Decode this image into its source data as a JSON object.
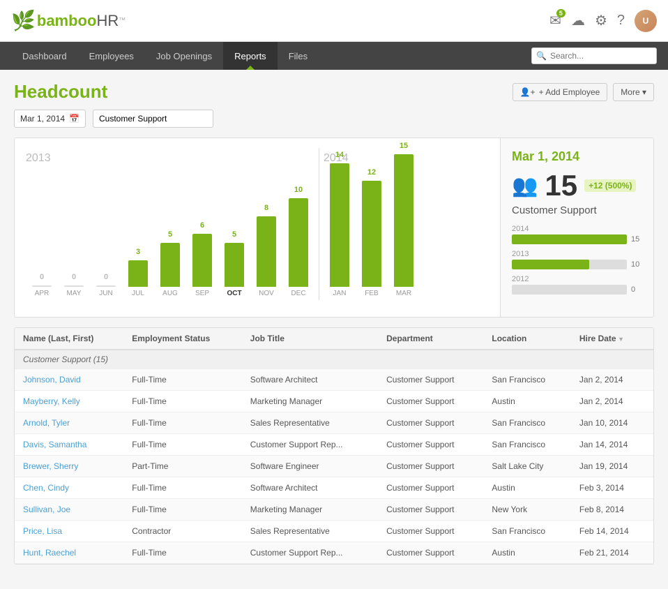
{
  "app": {
    "logo_bamboo": "bamboo",
    "logo_hr": "HR",
    "logo_tm": "™"
  },
  "top_icons": {
    "notifications_count": "5",
    "notifications_label": "Notifications",
    "cloud_label": "Cloud",
    "settings_label": "Settings",
    "help_label": "Help",
    "avatar_label": "User Avatar"
  },
  "nav": {
    "items": [
      {
        "label": "Dashboard",
        "active": false
      },
      {
        "label": "Employees",
        "active": false
      },
      {
        "label": "Job Openings",
        "active": false
      },
      {
        "label": "Reports",
        "active": true
      },
      {
        "label": "Files",
        "active": false
      }
    ],
    "search_placeholder": "Search..."
  },
  "page": {
    "title": "Headcount",
    "add_employee_label": "+ Add Employee",
    "more_label": "More ▾"
  },
  "filters": {
    "date_value": "Mar 1, 2014",
    "calendar_icon": "📅",
    "department_value": "Customer Support"
  },
  "chart": {
    "year_2013_label": "2013",
    "year_2014_label": "2014",
    "bars_2013": [
      {
        "month": "APR",
        "value": 0
      },
      {
        "month": "MAY",
        "value": 0
      },
      {
        "month": "JUN",
        "value": 0
      },
      {
        "month": "JUL",
        "value": 3
      },
      {
        "month": "AUG",
        "value": 5
      },
      {
        "month": "SEP",
        "value": 6
      },
      {
        "month": "OCT",
        "value": 5,
        "bold": true
      },
      {
        "month": "NOV",
        "value": 8
      },
      {
        "month": "DEC",
        "value": 10
      }
    ],
    "bars_2014": [
      {
        "month": "JAN",
        "value": 14
      },
      {
        "month": "FEB",
        "value": 12
      },
      {
        "month": "MAR",
        "value": 15
      }
    ],
    "max_value": 15
  },
  "summary": {
    "date_label": "Mar 1, 2014",
    "count": "15",
    "change_label": "+12 (500%)",
    "department": "Customer Support",
    "years": [
      {
        "year": "2014",
        "value": 15,
        "max": 15
      },
      {
        "year": "2013",
        "value": 10,
        "max": 15
      },
      {
        "year": "2012",
        "value": 0,
        "max": 15
      }
    ]
  },
  "table": {
    "columns": [
      {
        "label": "Name (Last, First)",
        "key": "name"
      },
      {
        "label": "Employment Status",
        "key": "status"
      },
      {
        "label": "Job Title",
        "key": "job_title"
      },
      {
        "label": "Department",
        "key": "department"
      },
      {
        "label": "Location",
        "key": "location"
      },
      {
        "label": "Hire Date",
        "key": "hire_date",
        "sortable": true
      }
    ],
    "group_label": "Customer Support (15)",
    "rows": [
      {
        "name": "Johnson, David",
        "status": "Full-Time",
        "job_title": "Software Architect",
        "department": "Customer Support",
        "location": "San Francisco",
        "hire_date": "Jan 2, 2014"
      },
      {
        "name": "Mayberry, Kelly",
        "status": "Full-Time",
        "job_title": "Marketing Manager",
        "department": "Customer Support",
        "location": "Austin",
        "hire_date": "Jan 2, 2014"
      },
      {
        "name": "Arnold, Tyler",
        "status": "Full-Time",
        "job_title": "Sales Representative",
        "department": "Customer Support",
        "location": "San Francisco",
        "hire_date": "Jan 10, 2014"
      },
      {
        "name": "Davis, Samantha",
        "status": "Full-Time",
        "job_title": "Customer Support Rep...",
        "department": "Customer Support",
        "location": "San Francisco",
        "hire_date": "Jan 14, 2014"
      },
      {
        "name": "Brewer, Sherry",
        "status": "Part-Time",
        "job_title": "Software Engineer",
        "department": "Customer Support",
        "location": "Salt Lake City",
        "hire_date": "Jan 19, 2014"
      },
      {
        "name": "Chen, Cindy",
        "status": "Full-Time",
        "job_title": "Software Architect",
        "department": "Customer Support",
        "location": "Austin",
        "hire_date": "Feb 3, 2014"
      },
      {
        "name": "Sullivan, Joe",
        "status": "Full-Time",
        "job_title": "Marketing Manager",
        "department": "Customer Support",
        "location": "New York",
        "hire_date": "Feb 8, 2014"
      },
      {
        "name": "Price, Lisa",
        "status": "Contractor",
        "job_title": "Sales Representative",
        "department": "Customer Support",
        "location": "San Francisco",
        "hire_date": "Feb 14, 2014"
      },
      {
        "name": "Hunt, Raechel",
        "status": "Full-Time",
        "job_title": "Customer Support Rep...",
        "department": "Customer Support",
        "location": "Austin",
        "hire_date": "Feb 21, 2014"
      }
    ]
  }
}
